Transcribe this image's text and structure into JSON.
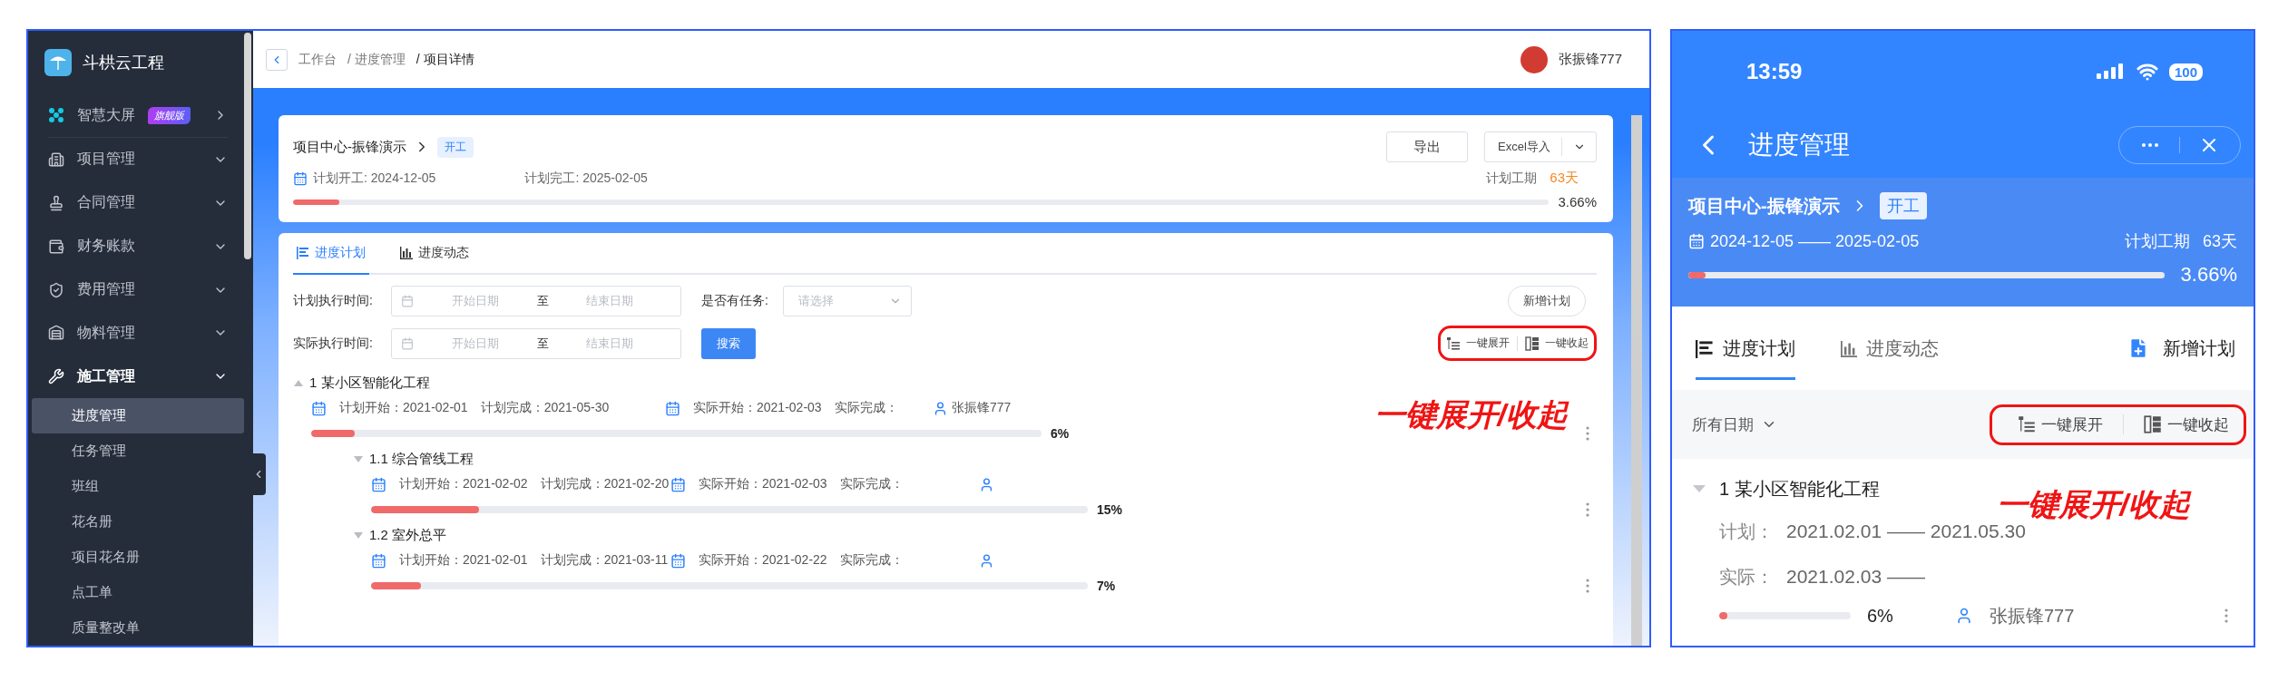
{
  "desktop": {
    "sidebar": {
      "logo": "斗栱云工程",
      "items": [
        {
          "label": "智慧大屏",
          "kind": "link",
          "badge": "旗舰版"
        },
        {
          "label": "项目管理",
          "kind": "menu",
          "expanded": false
        },
        {
          "label": "合同管理",
          "kind": "menu",
          "expanded": false
        },
        {
          "label": "财务账款",
          "kind": "menu",
          "expanded": false
        },
        {
          "label": "费用管理",
          "kind": "menu",
          "expanded": false
        },
        {
          "label": "物料管理",
          "kind": "menu",
          "expanded": false
        },
        {
          "label": "施工管理",
          "kind": "menu",
          "expanded": true,
          "children": [
            {
              "label": "进度管理",
              "selected": true
            },
            {
              "label": "任务管理",
              "selected": false
            },
            {
              "label": "班组",
              "selected": false
            },
            {
              "label": "花名册",
              "selected": false
            },
            {
              "label": "项目花名册",
              "selected": false
            },
            {
              "label": "点工单",
              "selected": false
            },
            {
              "label": "质量整改单",
              "selected": false
            }
          ]
        }
      ]
    },
    "breadcrumb": [
      "工作台",
      "/ 进度管理",
      "/ 项目详情"
    ],
    "user": "张振锋777",
    "project": {
      "title": "项目中心-振锋演示",
      "status": "开工",
      "planned_start": "计划开工: 2024-12-05",
      "planned_end": "计划完工: 2025-02-05",
      "duration_label": "计划工期",
      "duration": "63天",
      "level": 0.0366,
      "percent": "3.66%",
      "export_button": "导出",
      "import_button": "Excel导入"
    },
    "tabs": [
      {
        "label": "进度计划",
        "selected": true
      },
      {
        "label": "进度动态",
        "selected": false
      }
    ],
    "filters": {
      "plan_label": "计划执行时间:",
      "plan_range": {
        "start_placeholder": "开始日期",
        "to": "至",
        "end_placeholder": "结束日期"
      },
      "actual_label": "实际执行时间:",
      "actual_range": {
        "start_placeholder": "开始日期",
        "to": "至",
        "end_placeholder": "结束日期"
      },
      "task_label": "是否有任务:",
      "task_placeholder": "请选择",
      "search_button": "搜索",
      "add_button": "新增计划",
      "expand_button": "一键展开",
      "collapse_button": "一键收起"
    },
    "annotation": "一键展开/收起",
    "tasks": [
      {
        "title": "1 某小区智能化工程",
        "expanded": true,
        "plan_start": "计划开始：2021-02-01",
        "plan_end": "计划完成：2021-05-30",
        "actual_start": "实际开始：2021-02-03",
        "actual_end": "实际完成：",
        "assignee": "张振锋777",
        "level": 0.06,
        "percent": "6%",
        "children": [
          {
            "title": "1.1 综合管线工程",
            "expanded": false,
            "plan_start": "计划开始：2021-02-02",
            "plan_end": "计划完成：2021-02-20",
            "actual_start": "实际开始：2021-02-03",
            "actual_end": "实际完成：",
            "level": 0.15,
            "percent": "15%"
          },
          {
            "title": "1.2 室外总平",
            "expanded": false,
            "plan_start": "计划开始：2021-02-01",
            "plan_end": "计划完成：2021-03-11",
            "actual_start": "实际开始：2021-02-22",
            "actual_end": "实际完成：",
            "level": 0.07,
            "percent": "7%"
          }
        ]
      }
    ]
  },
  "mobile": {
    "time": "13:59",
    "battery": "100",
    "title": "进度管理",
    "project": {
      "title": "项目中心-振锋演示",
      "status": "开工",
      "dates": "2024-12-05 —— 2025-02-05",
      "duration_label": "计划工期",
      "duration": "63天",
      "level": 0.0366,
      "percent": "3.66%"
    },
    "tabs": [
      {
        "label": "进度计划",
        "selected": true
      },
      {
        "label": "进度动态",
        "selected": false
      }
    ],
    "add_button": "新增计划",
    "date_filter": "所有日期",
    "expand_button": "一键展开",
    "collapse_button": "一键收起",
    "annotation": "一键展开/收起",
    "task": {
      "title": "1 某小区智能化工程",
      "plan_label": "计划：",
      "plan": "2021.02.01 —— 2021.05.30",
      "actual_label": "实际：",
      "actual": "2021.02.03 ——",
      "level": 0.06,
      "percent": "6%",
      "assignee": "张振锋777"
    }
  }
}
